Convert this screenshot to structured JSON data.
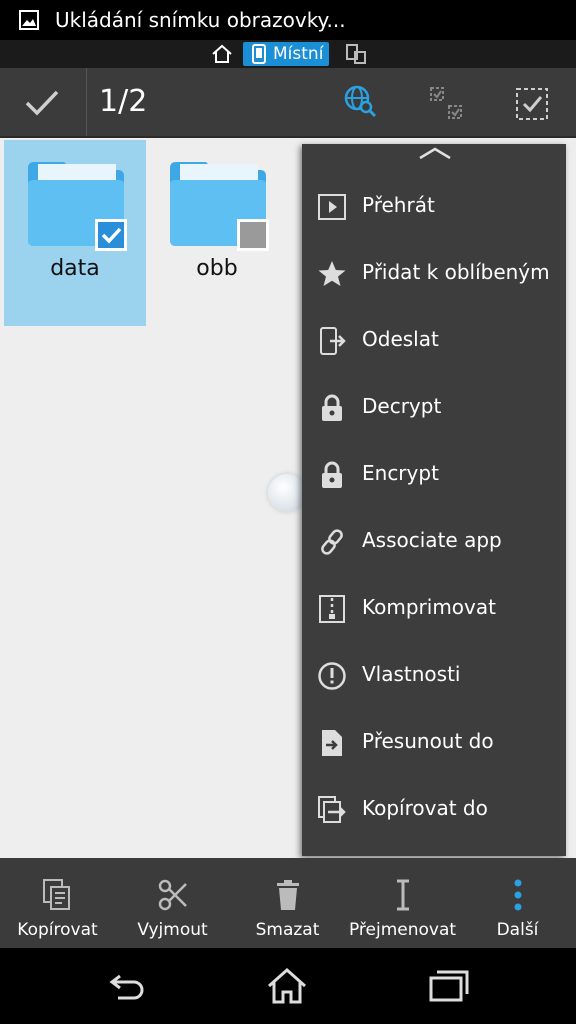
{
  "status_bar": {
    "notification_text": "Ukládání snímku obrazovky...",
    "icon": "image-icon"
  },
  "location_bar": {
    "home_icon": "home-icon",
    "local_label": "Místní",
    "device_icon": "device-icon"
  },
  "action_bar": {
    "selection_count": "1/2",
    "accent": "#1a8fd6"
  },
  "folders": [
    {
      "name": "data",
      "selected": true
    },
    {
      "name": "obb",
      "selected": false
    }
  ],
  "menu": {
    "items": [
      {
        "label": "Přehrát",
        "icon": "play-icon"
      },
      {
        "label": "Přidat k oblíbeným",
        "icon": "star-icon"
      },
      {
        "label": "Odeslat",
        "icon": "send-icon"
      },
      {
        "label": "Decrypt",
        "icon": "unlock-icon"
      },
      {
        "label": "Encrypt",
        "icon": "lock-icon"
      },
      {
        "label": "Associate app",
        "icon": "link-icon"
      },
      {
        "label": "Komprimovat",
        "icon": "zip-icon"
      },
      {
        "label": "Vlastnosti",
        "icon": "info-icon"
      },
      {
        "label": "Přesunout do",
        "icon": "move-icon"
      },
      {
        "label": "Kopírovat do",
        "icon": "copy-to-icon"
      }
    ]
  },
  "bottom_bar": {
    "items": [
      {
        "label": "Kopírovat",
        "icon": "copy-icon"
      },
      {
        "label": "Vyjmout",
        "icon": "cut-icon"
      },
      {
        "label": "Smazat",
        "icon": "delete-icon"
      },
      {
        "label": "Přejmenovat",
        "icon": "rename-icon"
      },
      {
        "label": "Další",
        "icon": "more-icon"
      }
    ]
  }
}
